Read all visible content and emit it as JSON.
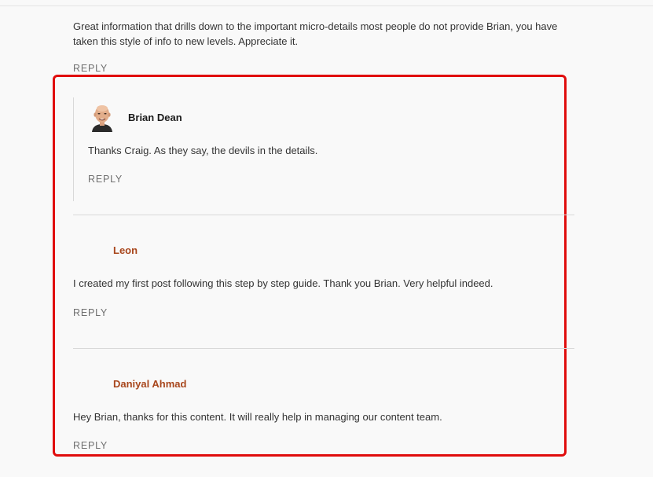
{
  "comments": [
    {
      "text": "Great information that drills down to the important micro-details most people do not provide Brian, you have taken this style of info to new levels. Appreciate it.",
      "reply_label": "REPLY"
    },
    {
      "author": "Brian Dean",
      "text": "Thanks Craig. As they say, the devils in the details.",
      "reply_label": "REPLY"
    },
    {
      "author": "Leon",
      "text": "I created my first post following this step by step guide. Thank you Brian. Very helpful indeed.",
      "reply_label": "REPLY"
    },
    {
      "author": "Daniyal Ahmad",
      "text": "Hey Brian, thanks for this content. It will really help in managing our content team.",
      "reply_label": "REPLY"
    }
  ],
  "colors": {
    "highlight": "#e00d0d",
    "author_link": "#a8461c",
    "background": "#f9f9f9"
  }
}
